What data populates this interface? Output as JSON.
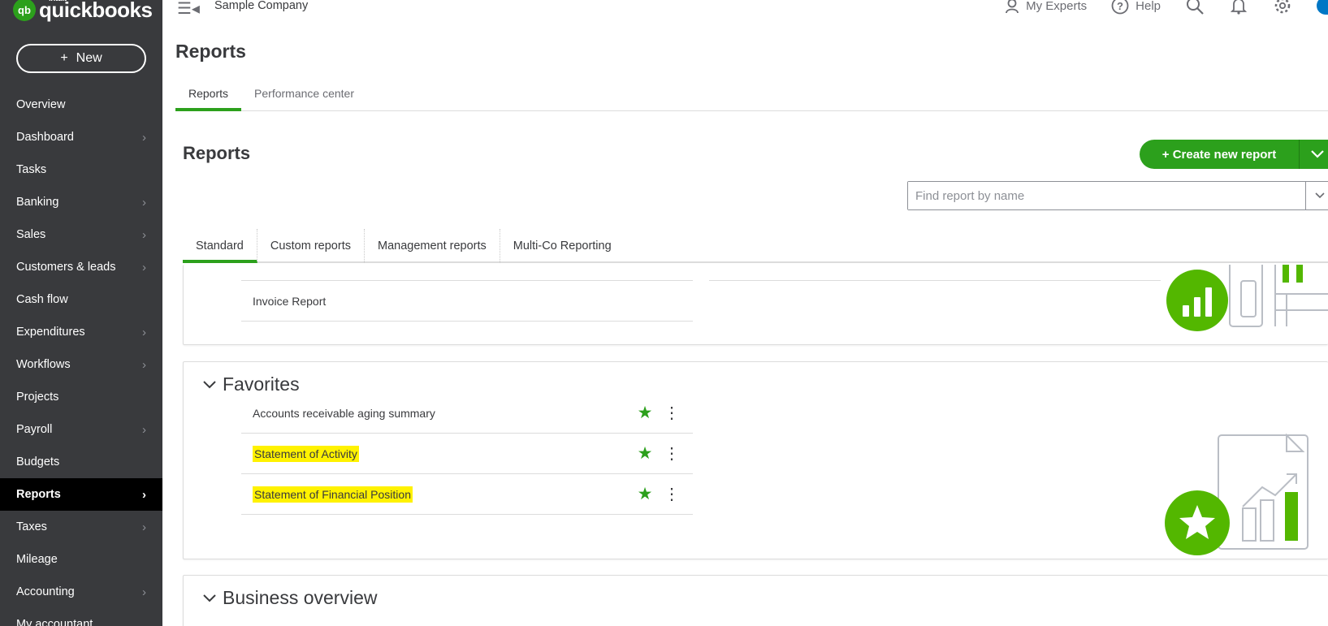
{
  "brand": {
    "intuit": "intuit",
    "name": "quickbooks",
    "mark": "qb"
  },
  "sidebar": {
    "new_button": {
      "plus": "+",
      "label": "New"
    },
    "items": [
      {
        "label": "Overview",
        "chevron": false
      },
      {
        "label": "Dashboard",
        "chevron": true
      },
      {
        "label": "Tasks",
        "chevron": false
      },
      {
        "label": "Banking",
        "chevron": true
      },
      {
        "label": "Sales",
        "chevron": true
      },
      {
        "label": "Customers & leads",
        "chevron": true
      },
      {
        "label": "Cash flow",
        "chevron": false
      },
      {
        "label": "Expenditures",
        "chevron": true
      },
      {
        "label": "Workflows",
        "chevron": true
      },
      {
        "label": "Projects",
        "chevron": false
      },
      {
        "label": "Payroll",
        "chevron": true
      },
      {
        "label": "Budgets",
        "chevron": false
      },
      {
        "label": "Reports",
        "chevron": true,
        "active": true
      },
      {
        "label": "Taxes",
        "chevron": true
      },
      {
        "label": "Mileage",
        "chevron": false
      },
      {
        "label": "Accounting",
        "chevron": true
      },
      {
        "label": "My accountant",
        "chevron": false
      }
    ]
  },
  "topbar": {
    "company": "Sample Company",
    "my_experts": "My Experts",
    "help": "Help",
    "icons": [
      "menu-collapse-icon",
      "experts-icon",
      "help-icon",
      "search-icon",
      "bell-icon",
      "gear-icon"
    ]
  },
  "page": {
    "title": "Reports",
    "tabs": [
      "Reports",
      "Performance center"
    ],
    "section_title": "Reports",
    "create_button": "+ Create new report",
    "search_placeholder": "Find report by name",
    "report_tabs": [
      "Standard",
      "Custom reports",
      "Management reports",
      "Multi-Co Reporting"
    ]
  },
  "sections": {
    "top": {
      "rows": [
        "Invoice Report"
      ]
    },
    "favorites": {
      "title": "Favorites",
      "rows": [
        {
          "label": "Accounts receivable aging summary",
          "highlighted": false
        },
        {
          "label": "Statement of Activity",
          "highlighted": true
        },
        {
          "label": "Statement of Financial Position",
          "highlighted": true
        }
      ]
    },
    "business_overview": {
      "title": "Business overview"
    }
  },
  "colors": {
    "sidebar_bg": "#393a3d",
    "active_bg": "#000000",
    "accent_green": "#2ca01c",
    "illustration_green": "#53b700",
    "highlight": "#fff200"
  }
}
